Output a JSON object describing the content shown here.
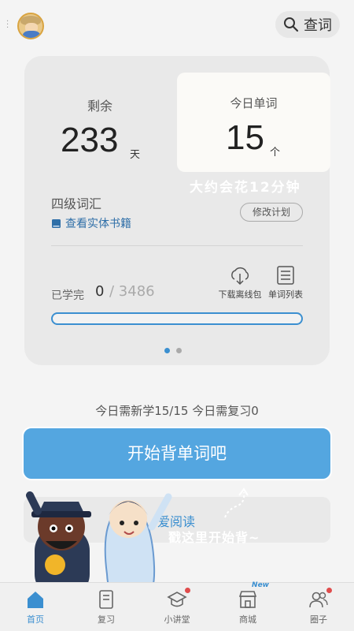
{
  "header": {
    "search_label": "查词"
  },
  "card": {
    "remain_label": "剩余",
    "remain_days": "233",
    "remain_unit": "天",
    "today_label": "今日单词",
    "today_count": "15",
    "today_unit": "个",
    "estimate_text": "大约会花12分钟",
    "book_name": "四级词汇",
    "book_link": "查看实体书籍",
    "modify_plan": "修改计划",
    "learned_label": "已学完",
    "learned_count": "0",
    "learned_total": "/ 3486",
    "progress_fraction": 0,
    "tool_download": "下载离线包",
    "tool_list": "单词列表"
  },
  "need_line": "今日需新学15/15  今日需复习0",
  "start_button": "开始背单词吧",
  "read_card": {
    "label": "爱阅读"
  },
  "hint": "戳这里开始背~",
  "tabs": [
    {
      "label": "首页",
      "active": true
    },
    {
      "label": "复习"
    },
    {
      "label": "小讲堂"
    },
    {
      "label": "商城",
      "tag": "New"
    },
    {
      "label": "圈子"
    }
  ],
  "colors": {
    "accent": "#3b8fd0",
    "button": "#54a6e0",
    "badge": "#e04c4c"
  }
}
